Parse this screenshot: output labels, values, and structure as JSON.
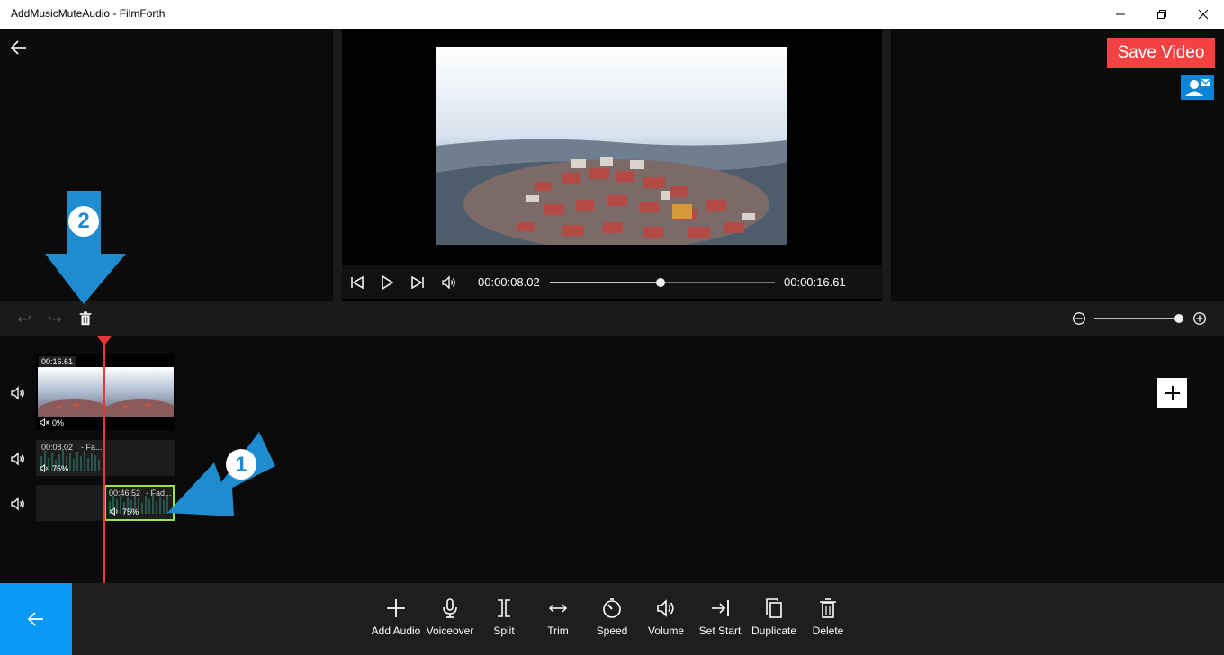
{
  "window": {
    "title": "AddMusicMuteAudio - FilmForth"
  },
  "header": {
    "save_label": "Save Video"
  },
  "player": {
    "current_time": "00:00:08.02",
    "total_time": "00:00:16.61",
    "progress": 0.49
  },
  "timeline": {
    "video_clip": {
      "duration": "00:16.61",
      "volume": "0%"
    },
    "audio_clip_1": {
      "duration": "00:08.02",
      "title": "- Fa...",
      "volume": "75%"
    },
    "audio_clip_2": {
      "duration": "00:46.52",
      "title": "- Fad...",
      "volume": "75%"
    }
  },
  "tools": [
    {
      "label": "Add Audio",
      "icon": "plus-icon"
    },
    {
      "label": "Voiceover",
      "icon": "microphone-icon"
    },
    {
      "label": "Split",
      "icon": "split-icon"
    },
    {
      "label": "Trim",
      "icon": "trim-icon"
    },
    {
      "label": "Speed",
      "icon": "speed-icon"
    },
    {
      "label": "Volume",
      "icon": "volume-icon"
    },
    {
      "label": "Set Start",
      "icon": "set-start-icon"
    },
    {
      "label": "Duplicate",
      "icon": "duplicate-icon"
    },
    {
      "label": "Delete",
      "icon": "trash-icon"
    }
  ],
  "annotations": {
    "step1": "1",
    "step2": "2"
  },
  "colors": {
    "save": "#f44242",
    "accent": "#0a9af5",
    "playhead": "#e53935",
    "selected_clip": "#9be24a",
    "arrow": "#1e8ccf"
  }
}
